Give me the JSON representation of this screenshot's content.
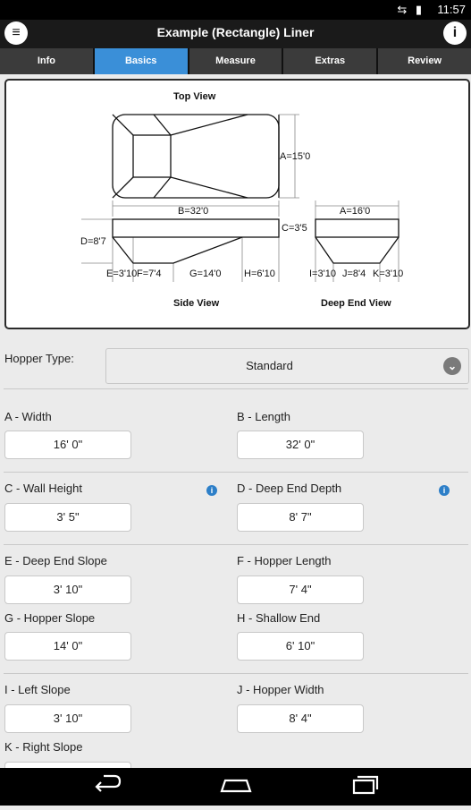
{
  "status_bar": {
    "signal_icons": "⇆ ▮",
    "time": "11:57"
  },
  "app_bar": {
    "title": "Example (Rectangle) Liner",
    "menu_icon": "menu-icon",
    "info_icon": "info-icon"
  },
  "tabs": [
    {
      "label": "Info",
      "active": false
    },
    {
      "label": "Basics",
      "active": true
    },
    {
      "label": "Measure",
      "active": false
    },
    {
      "label": "Extras",
      "active": false
    },
    {
      "label": "Review",
      "active": false
    }
  ],
  "diagram": {
    "top_view_label": "Top View",
    "side_view_label": "Side View",
    "deep_end_view_label": "Deep End View",
    "dim_a_top": "A=15'0",
    "dim_b": "B=32'0",
    "dim_c": "C=3'5",
    "dim_d": "D=8'7",
    "dim_a_deep": "A=16'0",
    "dim_e": "E=3'10",
    "dim_f": "F=7'4",
    "dim_g": "G=14'0",
    "dim_h": "H=6'10",
    "dim_i": "I=3'10",
    "dim_j": "J=8'4",
    "dim_k": "K=3'10"
  },
  "hopper": {
    "label": "Hopper Type:",
    "value": "Standard"
  },
  "fields": {
    "a_label": "A - Width",
    "a_value": "16' 0\"",
    "b_label": "B - Length",
    "b_value": "32' 0\"",
    "c_label": "C - Wall Height",
    "c_value": "3' 5\"",
    "d_label": "D - Deep End Depth",
    "d_value": "8' 7\"",
    "e_label": "E - Deep End Slope",
    "e_value": "3' 10\"",
    "f_label": "F - Hopper Length",
    "f_value": "7' 4\"",
    "g_label": "G - Hopper Slope",
    "g_value": "14' 0\"",
    "h_label": "H - Shallow End",
    "h_value": "6' 10\"",
    "i_label": "I - Left Slope",
    "i_value": "3' 10\"",
    "j_label": "J - Hopper Width",
    "j_value": "8' 4\"",
    "k_label": "K - Right Slope"
  },
  "colors": {
    "accent_tab": "#3a8fd8",
    "info_icon": "#2d7fc8"
  },
  "nav_bar": {
    "back_icon": "back-icon",
    "home_icon": "home-icon",
    "recents_icon": "recents-icon"
  }
}
